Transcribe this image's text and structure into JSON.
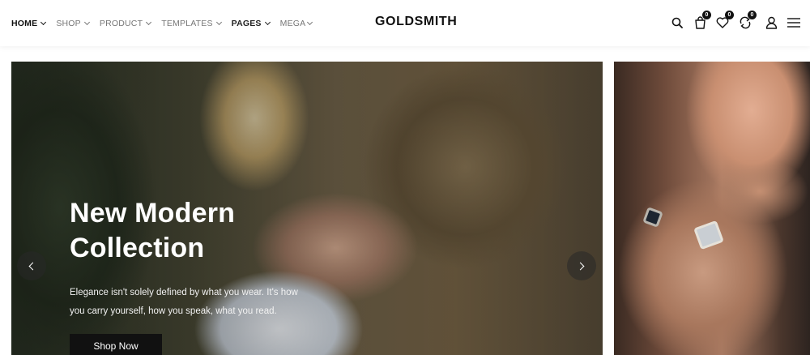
{
  "header": {
    "nav": [
      {
        "label": "HOME",
        "style": "active"
      },
      {
        "label": "SHOP",
        "style": "muted"
      },
      {
        "label": "PRODUCT",
        "style": "muted"
      },
      {
        "label": "TEMPLATES",
        "style": "muted"
      },
      {
        "label": "PAGES",
        "style": "dark"
      },
      {
        "label": "MEGA",
        "style": "muted"
      }
    ],
    "logo": "GOLDSMITH",
    "icons": {
      "search": "search-icon",
      "cart": {
        "icon": "bag-icon",
        "count": "0"
      },
      "wishlist": {
        "icon": "heart-icon",
        "count": "0"
      },
      "compare": {
        "icon": "compare-icon",
        "count": "0"
      },
      "account": "user-icon",
      "menu": "hamburger-icon"
    }
  },
  "hero": {
    "title": "New Modern Collection",
    "description": "Elegance isn't solely defined by what you wear. It's how you carry yourself, how you speak, what you read.",
    "button_label": "Shop Now",
    "prev_icon": "chevron-left-icon",
    "next_icon": "chevron-right-icon"
  },
  "colors": {
    "text_dark": "#111111",
    "text_muted": "#777777",
    "button_bg": "#111111"
  }
}
